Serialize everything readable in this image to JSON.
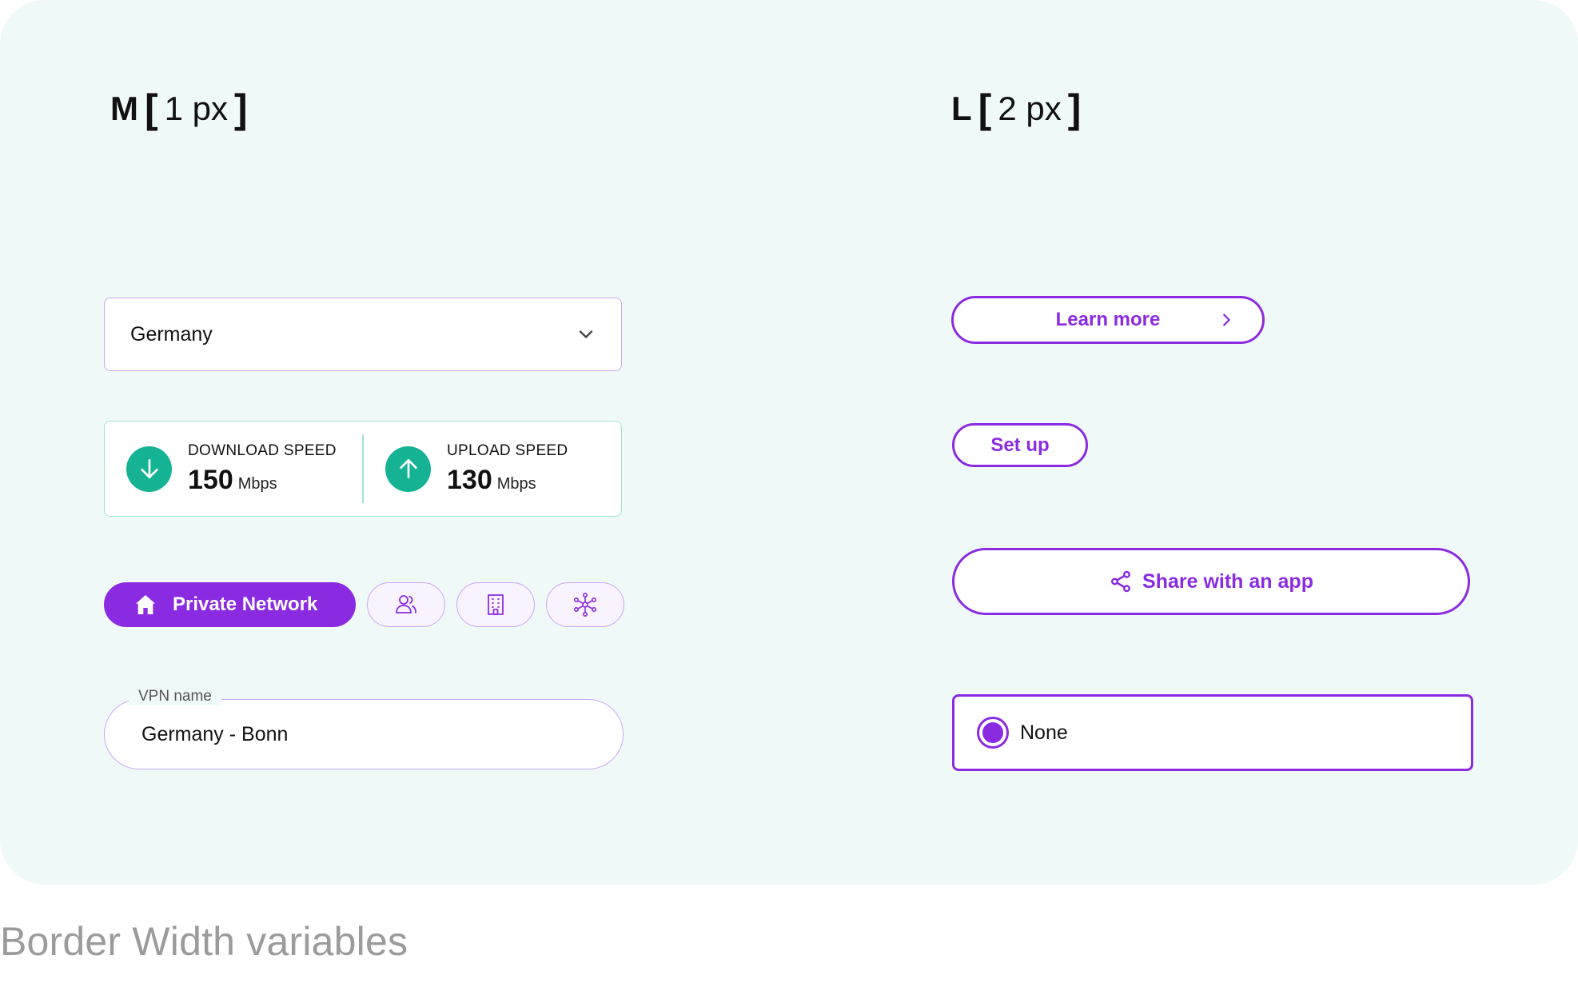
{
  "headings": {
    "left": {
      "level": "M",
      "open": "[",
      "value": "1 px",
      "close": "]"
    },
    "right": {
      "level": "L",
      "open": "[",
      "value": "2 px",
      "close": "]"
    }
  },
  "dropdown": {
    "value": "Germany",
    "icon": "chevron-down-icon"
  },
  "speed": {
    "download": {
      "label": "DOWNLOAD SPEED",
      "value": "150",
      "unit": "Mbps",
      "icon": "arrow-down-icon"
    },
    "upload": {
      "label": "UPLOAD SPEED",
      "value": "130",
      "unit": "Mbps",
      "icon": "arrow-up-icon"
    }
  },
  "network_types": {
    "selected": {
      "label": "Private Network",
      "icon": "home-icon"
    },
    "others": [
      {
        "icon": "users-icon"
      },
      {
        "icon": "building-icon"
      },
      {
        "icon": "network-icon"
      }
    ]
  },
  "vpn_field": {
    "legend": "VPN name",
    "value": "Germany - Bonn"
  },
  "buttons": {
    "learn_more": "Learn more",
    "set_up": "Set up",
    "share": "Share with an app"
  },
  "radio": {
    "label": "None",
    "selected": true
  },
  "caption": "Border Width variables",
  "colors": {
    "panel_bg": "#eff9f7",
    "accent": "#8a2be2",
    "accent_light": "#c9a8f5",
    "success": "#15b394",
    "success_border": "#9ee3d6",
    "caption": "#9b9b9b"
  }
}
